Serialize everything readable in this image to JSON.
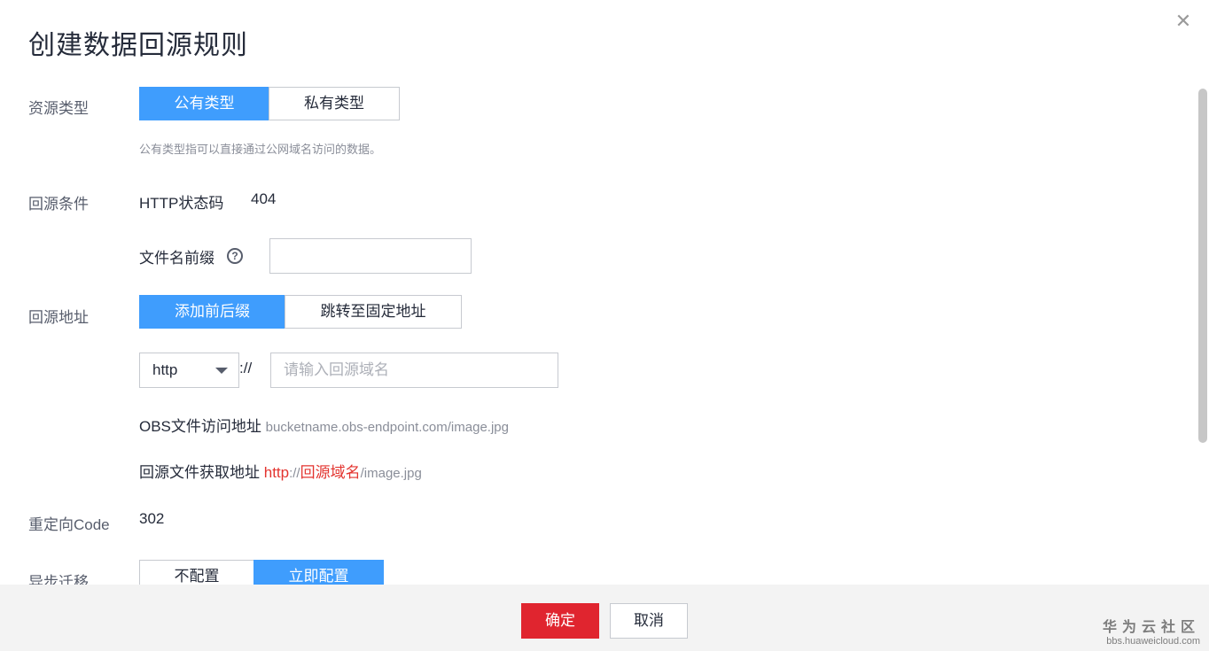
{
  "dialog": {
    "title": "创建数据回源规则",
    "close_icon": "close-icon"
  },
  "resource_type": {
    "label": "资源类型",
    "options": [
      "公有类型",
      "私有类型"
    ],
    "selected": "公有类型",
    "hint": "公有类型指可以直接通过公网域名访问的数据。"
  },
  "origin_condition": {
    "label": "回源条件",
    "http_status_label": "HTTP状态码",
    "http_status_value": "404",
    "prefix_label": "文件名前缀",
    "prefix_value": "",
    "help_icon": "question-circle-icon",
    "help_glyph": "?"
  },
  "origin_address": {
    "label": "回源地址",
    "options": [
      "添加前后缀",
      "跳转至固定地址"
    ],
    "selected": "添加前后缀",
    "protocol_value": "http",
    "protocol_separator": "://",
    "domain_placeholder": "请输入回源域名",
    "domain_value": "",
    "obs_label": "OBS文件访问地址",
    "obs_example": "bucketname.obs-endpoint.com/image.jpg",
    "fetch_label": "回源文件获取地址",
    "fetch_example_protocol": "http",
    "fetch_example_sep": "://",
    "fetch_example_domain": "回源域名",
    "fetch_example_path": "/image.jpg"
  },
  "redirect_code": {
    "label": "重定向Code",
    "value": "302"
  },
  "async_migration": {
    "label": "异步迁移",
    "options": [
      "不配置",
      "立即配置"
    ],
    "selected": "立即配置"
  },
  "footer": {
    "confirm_label": "确定",
    "cancel_label": "取消"
  },
  "watermark": {
    "main": "华为云社区",
    "sub": "bbs.huaweicloud.com"
  },
  "colors": {
    "primary_blue": "#3f9dfd",
    "confirm_red": "#e0252f",
    "link_red": "#e3342f"
  }
}
